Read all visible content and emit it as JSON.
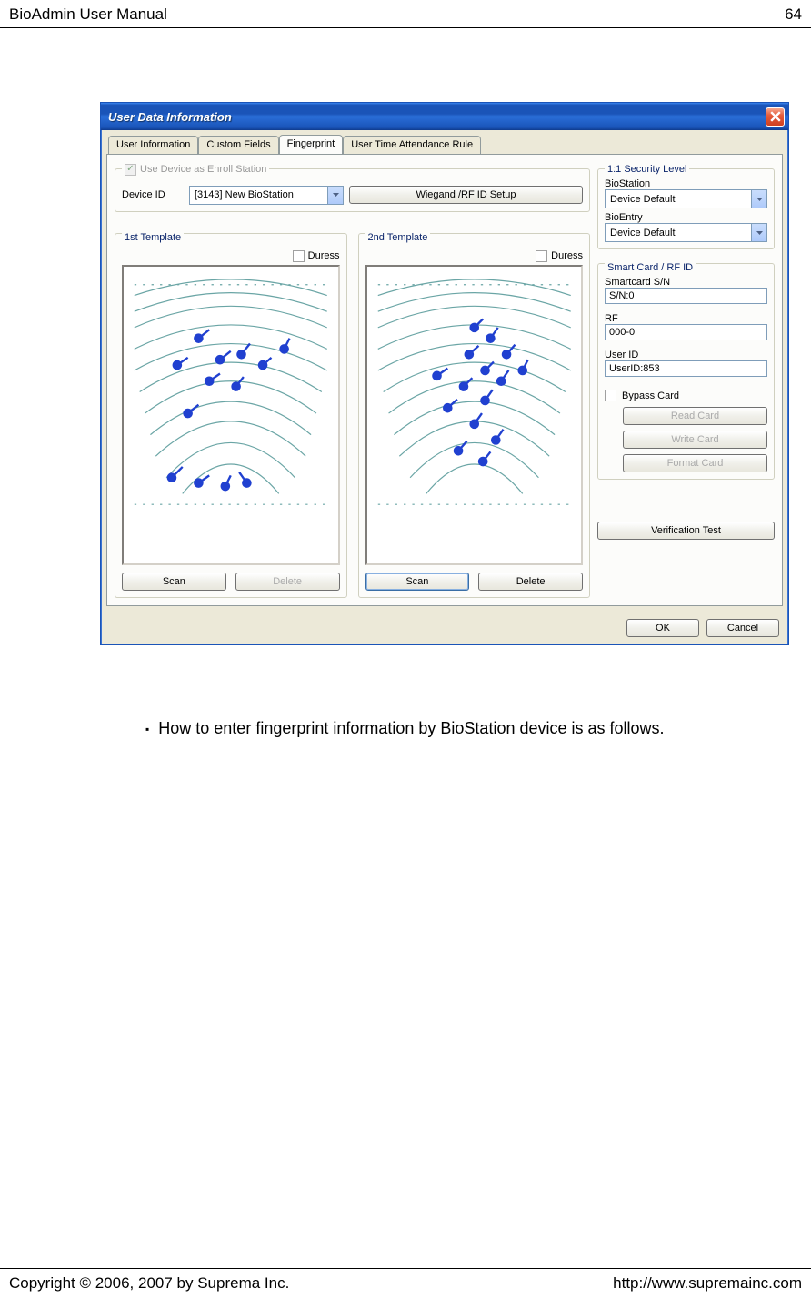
{
  "doc": {
    "header_left": "BioAdmin User Manual",
    "header_right": "64",
    "footer_left": "Copyright © 2006, 2007 by Suprema Inc.",
    "footer_right": "http://www.supremainc.com",
    "bullet_text": "How to enter fingerprint information by BioStation device is as follows."
  },
  "dialog": {
    "title": "User Data Information",
    "tabs": [
      "User Information",
      "Custom Fields",
      "Fingerprint",
      "User Time Attendance Rule"
    ],
    "active_tab": 2,
    "enroll_group": {
      "legend": "Use Device as Enroll Station",
      "device_id_label": "Device ID",
      "device_combo": "[3143] New BioStation",
      "wiegand_btn": "Wiegand /RF ID Setup"
    },
    "security_group": {
      "legend": "1:1 Security Level",
      "biostation_label": "BioStation",
      "biostation_value": "Device Default",
      "bioentry_label": "BioEntry",
      "bioentry_value": "Device Default"
    },
    "template1": {
      "legend": "1st Template",
      "duress_label": "Duress",
      "scan_btn": "Scan",
      "delete_btn": "Delete"
    },
    "template2": {
      "legend": "2nd Template",
      "duress_label": "Duress",
      "scan_btn": "Scan",
      "delete_btn": "Delete"
    },
    "smartcard_group": {
      "legend": "Smart Card / RF ID",
      "sn_label": "Smartcard S/N",
      "sn_value": "S/N:0",
      "rf_label": "RF",
      "rf_value": "000-0",
      "userid_label": "User ID",
      "userid_value": "UserID:853",
      "bypass_label": "Bypass Card",
      "read_btn": "Read Card",
      "write_btn": "Write Card",
      "format_btn": "Format Card"
    },
    "verification_btn": "Verification Test",
    "ok_btn": "OK",
    "cancel_btn": "Cancel"
  }
}
